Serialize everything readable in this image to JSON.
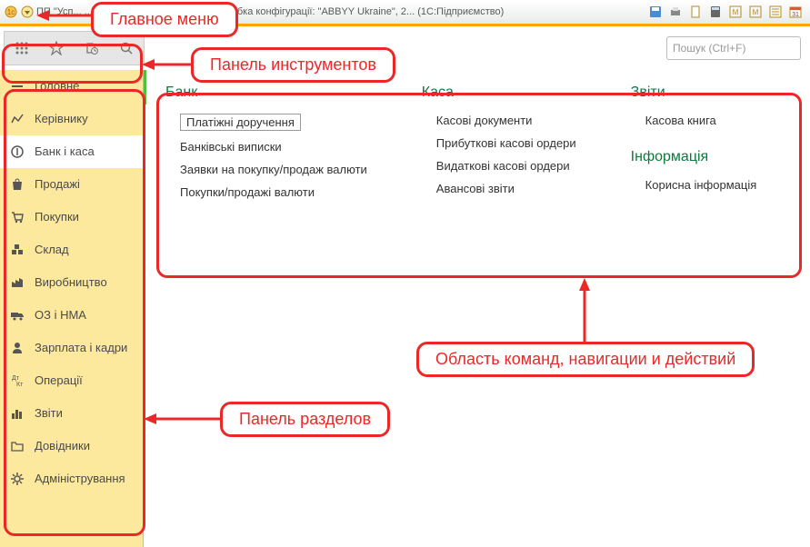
{
  "titlebar": {
    "text": "ПП \"Усп...                        ...ля України, редакція 2.0. Розробка конфігурації: \"ABBYY Ukraine\", 2... (1С:Підприємство)"
  },
  "search": {
    "placeholder": "Пошук (Ctrl+F)"
  },
  "sidebar": {
    "items": [
      {
        "label": "Головне"
      },
      {
        "label": "Керівнику"
      },
      {
        "label": "Банк і каса"
      },
      {
        "label": "Продажі"
      },
      {
        "label": "Покупки"
      },
      {
        "label": "Склад"
      },
      {
        "label": "Виробництво"
      },
      {
        "label": "ОЗ і НМА"
      },
      {
        "label": "Зарплата і кадри"
      },
      {
        "label": "Операції"
      },
      {
        "label": "Звіти"
      },
      {
        "label": "Довідники"
      },
      {
        "label": "Адміністрування"
      }
    ]
  },
  "content": {
    "col1": {
      "heading": "Банк",
      "links": [
        "Платіжні доручення",
        "Банківські виписки",
        "Заявки на покупку/продаж валюти",
        "Покупки/продажі валюти"
      ]
    },
    "col2": {
      "heading": "Каса",
      "links": [
        "Касові документи",
        "Прибуткові касові ордери",
        "Видаткові касові ордери",
        "Авансові звіти"
      ]
    },
    "col3": {
      "heading1": "Звіти",
      "link1": "Касова книга",
      "heading2": "Інформація",
      "link2": "Корисна інформація"
    }
  },
  "callouts": {
    "mainmenu": "Главное меню",
    "toolbar": "Панель инструментов",
    "sections": "Панель разделов",
    "commands": "Область команд, навигации и действий"
  }
}
